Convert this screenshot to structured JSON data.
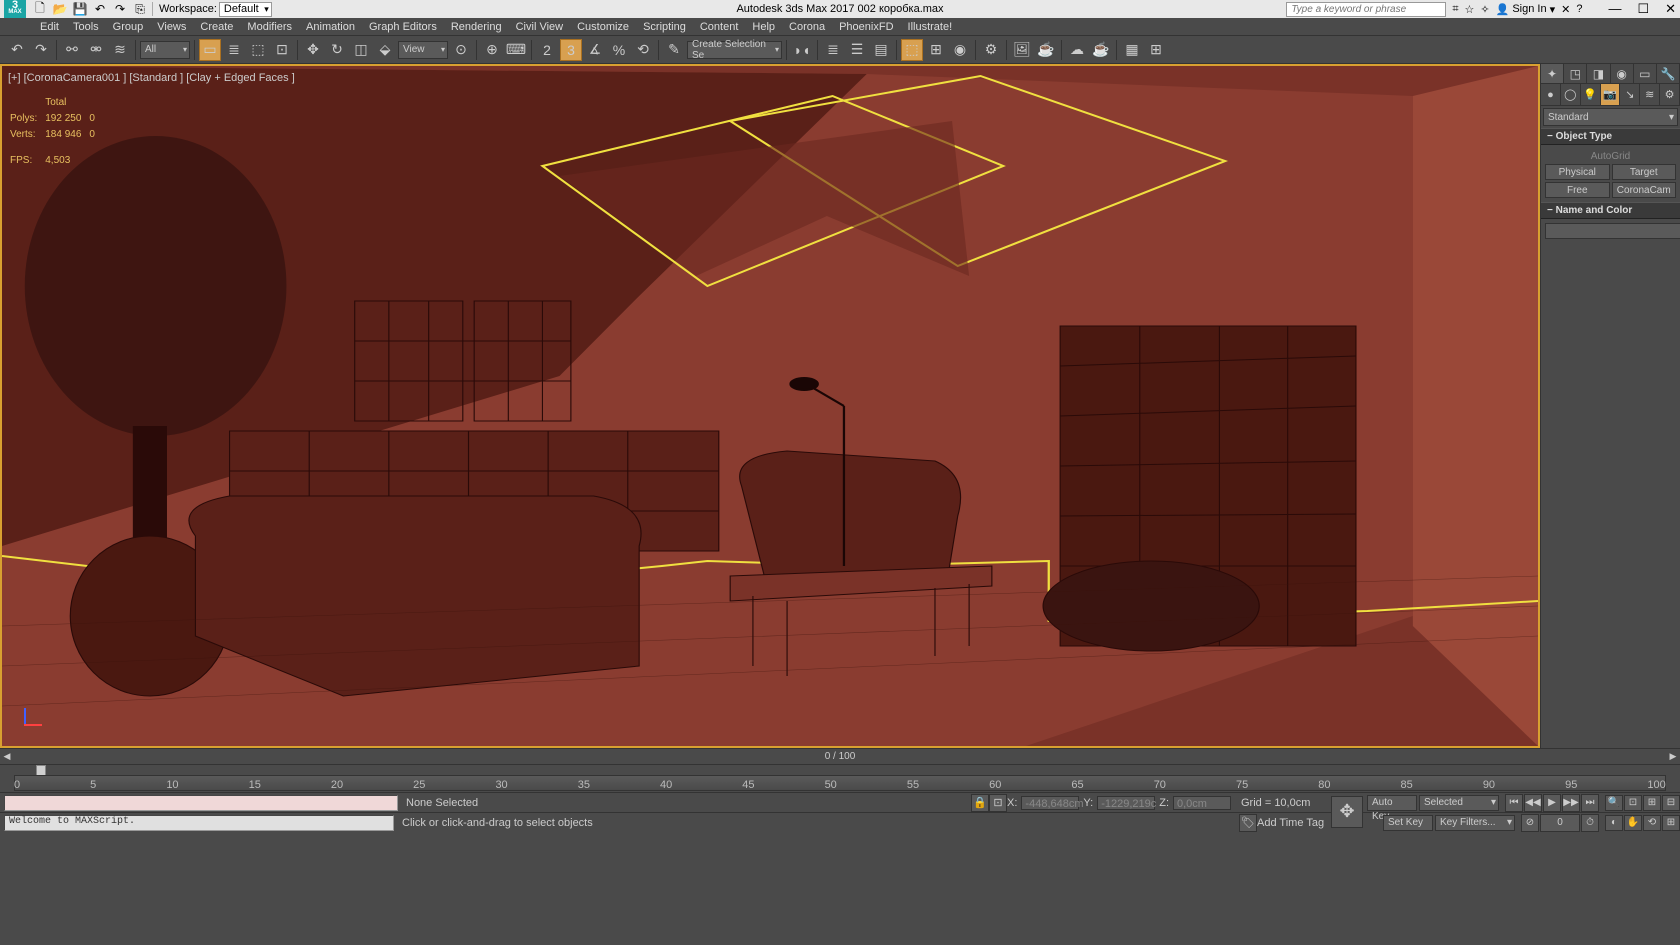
{
  "titlebar": {
    "workspace_label": "Workspace:",
    "workspace_value": "Default",
    "app_title": "Autodesk 3ds Max 2017   002 коробка.max",
    "search_placeholder": "Type a keyword or phrase",
    "signin": "Sign In"
  },
  "menu": [
    "Edit",
    "Tools",
    "Group",
    "Views",
    "Create",
    "Modifiers",
    "Animation",
    "Graph Editors",
    "Rendering",
    "Civil View",
    "Customize",
    "Scripting",
    "Content",
    "Help",
    "Corona",
    "PhoenixFD",
    "Illustrate!"
  ],
  "toolbar": {
    "filter": "All",
    "view": "View",
    "selection_set": "Create Selection Se"
  },
  "viewport": {
    "label": "[+] [CoronaCamera001 ] [Standard ] [Clay + Edged Faces ]",
    "stats": {
      "header": [
        "",
        "Total",
        ""
      ],
      "polys": [
        "Polys:",
        "192 250",
        "0"
      ],
      "verts": [
        "Verts:",
        "184 946",
        "0"
      ],
      "fps": [
        "FPS:",
        "4,503",
        ""
      ]
    }
  },
  "cmdpanel": {
    "category_dd": "Standard",
    "object_type_title": "Object Type",
    "autogrid": "AutoGrid",
    "buttons": [
      "Physical",
      "Target",
      "Free",
      "CoronaCam"
    ],
    "name_color_title": "Name and Color"
  },
  "slider": {
    "value": "0 / 100"
  },
  "timeline_ticks": [
    "0",
    "5",
    "10",
    "15",
    "20",
    "25",
    "30",
    "35",
    "40",
    "45",
    "50",
    "55",
    "60",
    "65",
    "70",
    "75",
    "80",
    "85",
    "90",
    "95",
    "100"
  ],
  "status": {
    "maxscript": "Welcome to MAXScript.",
    "selection": "None Selected",
    "hint": "Click or click-and-drag to select objects",
    "x_label": "X:",
    "x_val": "-448,648cm",
    "y_label": "Y:",
    "y_val": "-1229,219c",
    "z_label": "Z:",
    "z_val": "0,0cm",
    "grid": "Grid = 10,0cm",
    "add_tag": "Add Time Tag",
    "auto_key": "Auto Key",
    "set_key": "Set Key",
    "selected": "Selected",
    "key_filters": "Key Filters..."
  }
}
